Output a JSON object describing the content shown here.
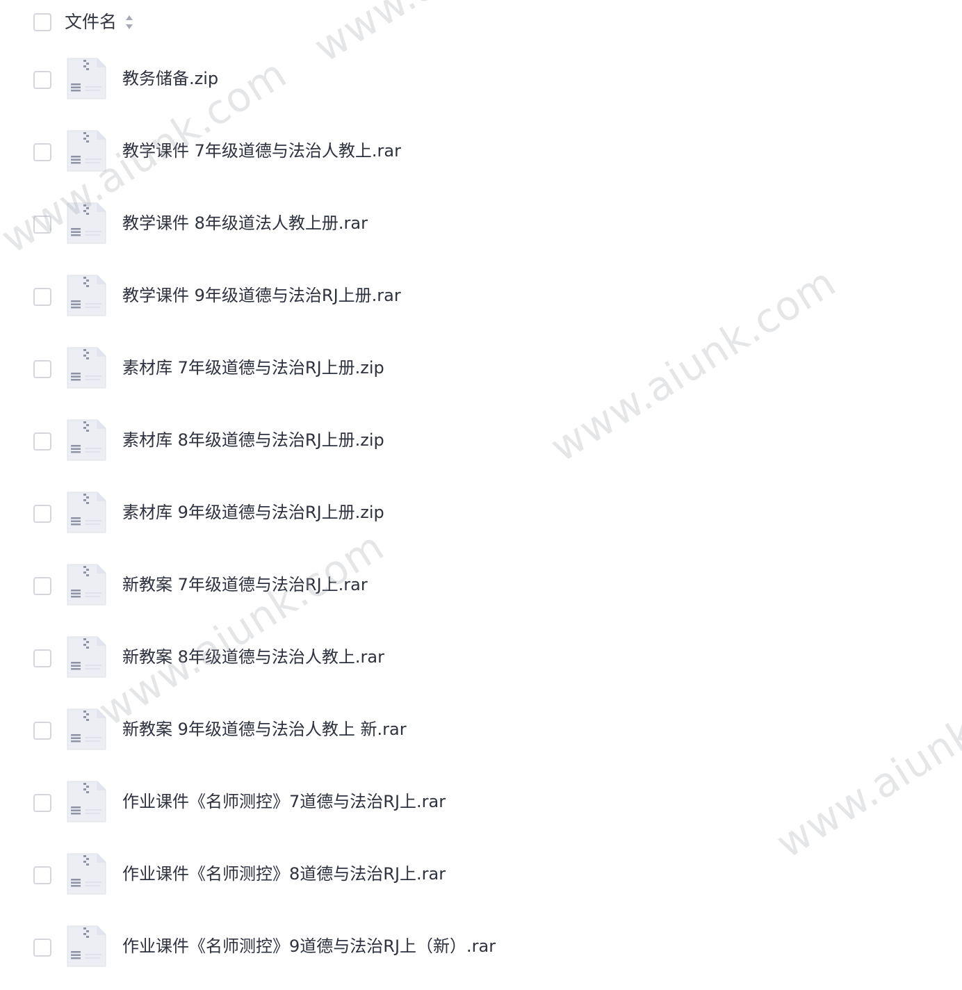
{
  "header": {
    "column_label": "文件名",
    "sort_icon": "sort-updown-icon"
  },
  "file_icon": "zip-archive-icon",
  "files": [
    {
      "name": "教务储备.zip"
    },
    {
      "name": "教学课件 7年级道德与法治人教上.rar"
    },
    {
      "name": "教学课件 8年级道法人教上册.rar"
    },
    {
      "name": "教学课件 9年级道德与法治RJ上册.rar"
    },
    {
      "name": "素材库 7年级道德与法治RJ上册.zip"
    },
    {
      "name": "素材库 8年级道德与法治RJ上册.zip"
    },
    {
      "name": "素材库 9年级道德与法治RJ上册.zip"
    },
    {
      "name": "新教案 7年级道德与法治RJ上.rar"
    },
    {
      "name": "新教案 8年级道德与法治人教上.rar"
    },
    {
      "name": "新教案 9年级道德与法治人教上 新.rar"
    },
    {
      "name": "作业课件《名师测控》7道德与法治RJ上.rar"
    },
    {
      "name": "作业课件《名师测控》8道德与法治RJ上.rar"
    },
    {
      "name": "作业课件《名师测控》9道德与法治RJ上（新）.rar"
    }
  ],
  "watermarks": [
    {
      "text": "www.aiunk.com"
    },
    {
      "text": "www.aiunk.com"
    },
    {
      "text": "www.aiunk.com"
    },
    {
      "text": "www.aiunk.com"
    },
    {
      "text": "www.aiunk.com"
    }
  ],
  "colors": {
    "text": "#2d3140",
    "checkbox_border": "#d4d6dc",
    "icon_fill": "#eceef4",
    "icon_accent": "#8e94a8"
  }
}
